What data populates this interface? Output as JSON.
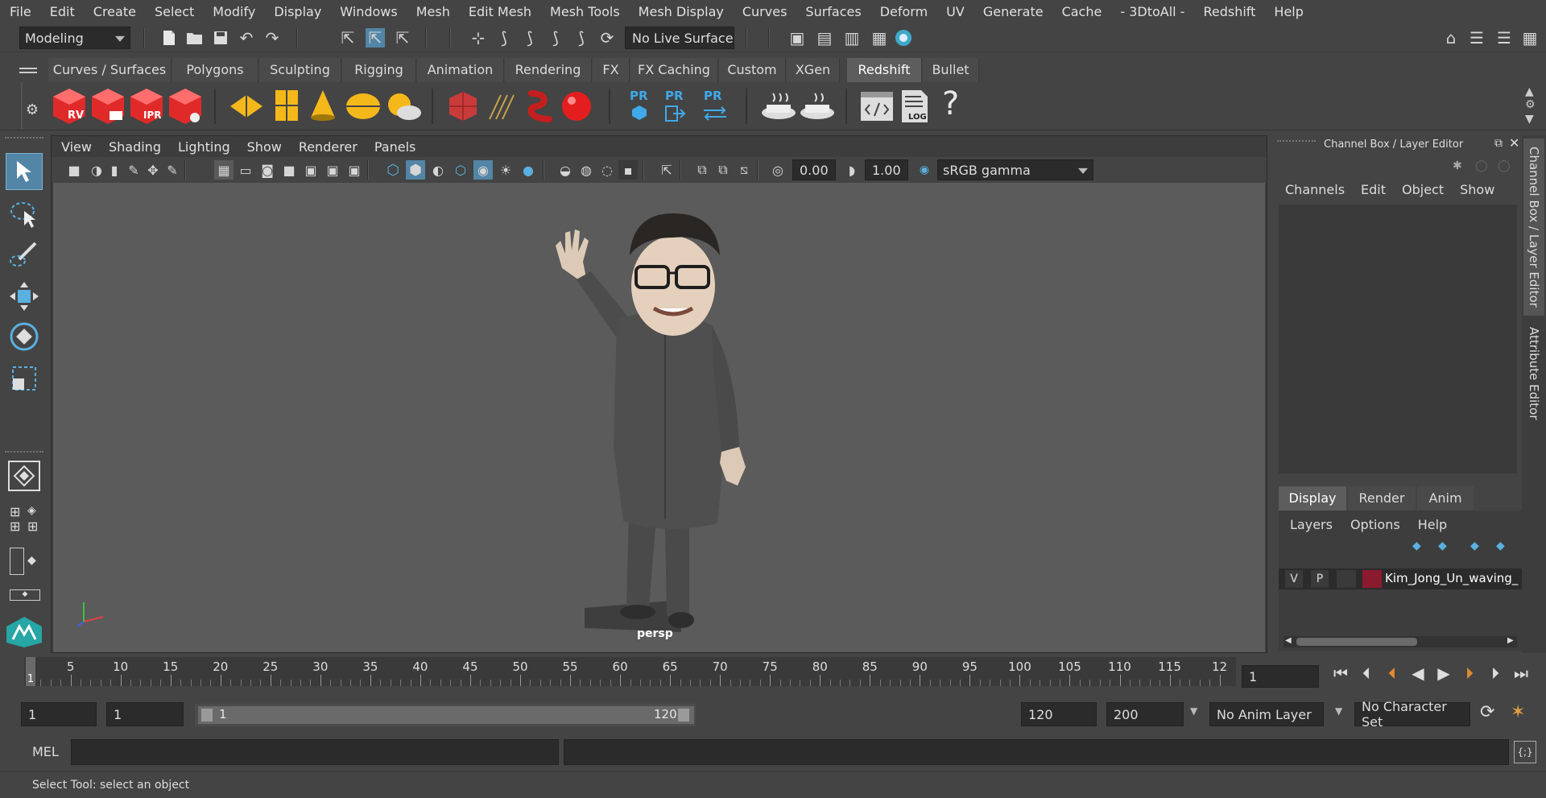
{
  "menubar": {
    "items": [
      "File",
      "Edit",
      "Create",
      "Select",
      "Modify",
      "Display",
      "Windows",
      "Mesh",
      "Edit Mesh",
      "Mesh Tools",
      "Mesh Display",
      "Curves",
      "Surfaces",
      "Deform",
      "UV",
      "Generate",
      "Cache",
      "- 3DtoAll -",
      "Redshift",
      "Help"
    ]
  },
  "statusline": {
    "mode": "Modeling",
    "live_surface": "No Live Surface"
  },
  "shelf": {
    "tabs": [
      "Curves / Surfaces",
      "Polygons",
      "Sculpting",
      "Rigging",
      "Animation",
      "Rendering",
      "FX",
      "FX Caching",
      "Custom",
      "XGen",
      "Redshift",
      "Bullet"
    ],
    "active_tab": "Redshift",
    "rs_labels": {
      "rv": "RV",
      "ipr": "IPR",
      "pr": "PR",
      "log": "LOG",
      "help": "?"
    }
  },
  "viewport": {
    "menu": [
      "View",
      "Shading",
      "Lighting",
      "Show",
      "Renderer",
      "Panels"
    ],
    "exposure": "0.00",
    "gamma": "1.00",
    "color_space": "sRGB gamma",
    "camera_label": "persp"
  },
  "channel_box": {
    "title": "Channel Box / Layer Editor",
    "menu": [
      "Channels",
      "Edit",
      "Object",
      "Show"
    ]
  },
  "layer_editor": {
    "tabs": [
      "Display",
      "Render",
      "Anim"
    ],
    "active_tab": "Display",
    "menu": [
      "Layers",
      "Options",
      "Help"
    ],
    "layer": {
      "v": "V",
      "p": "P",
      "name": "Kim_Jong_Un_waving_",
      "color": "#8b1a2e"
    }
  },
  "side_tabs": [
    "Channel Box / Layer Editor",
    "Attribute Editor"
  ],
  "timeline": {
    "ticks": [
      "5",
      "10",
      "15",
      "20",
      "25",
      "30",
      "35",
      "40",
      "45",
      "50",
      "55",
      "60",
      "65",
      "70",
      "75",
      "80",
      "85",
      "90",
      "95",
      "100",
      "105",
      "110",
      "115",
      "12"
    ],
    "current_frame_marker": "1",
    "current_frame": "1"
  },
  "range": {
    "start": "1",
    "playback_start": "1",
    "slider_start": "1",
    "slider_end": "120",
    "playback_end": "120",
    "end": "200",
    "anim_layer": "No Anim Layer",
    "character_set": "No Character Set"
  },
  "command_line": {
    "label": "MEL"
  },
  "help_line": {
    "text": "Select Tool: select an object"
  },
  "colors": {
    "accent": "#5285a6",
    "background": "#444444",
    "viewport": "#5b5b5b"
  }
}
